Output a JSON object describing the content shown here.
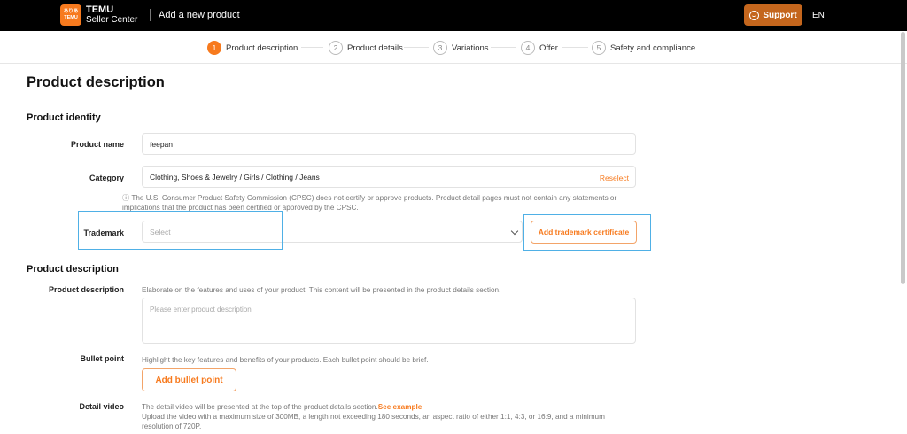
{
  "header": {
    "logo_line1": "ありあ",
    "logo_line2": "TEMU",
    "brand_name": "TEMU",
    "brand_sub": "Seller Center",
    "page_title": "Add a new product",
    "support_label": "Support",
    "language": "EN"
  },
  "steps": [
    {
      "num": "1",
      "label": "Product description"
    },
    {
      "num": "2",
      "label": "Product details"
    },
    {
      "num": "3",
      "label": "Variations"
    },
    {
      "num": "4",
      "label": "Offer"
    },
    {
      "num": "5",
      "label": "Safety and compliance"
    }
  ],
  "main": {
    "title": "Product description",
    "identity": {
      "section_title": "Product identity",
      "product_name_label": "Product name",
      "product_name_value": "feepan",
      "category_label": "Category",
      "category_value": "Clothing, Shoes & Jewelry / Girls / Clothing / Jeans",
      "reselect_label": "Reselect",
      "cpsc_note_line1": "ⓘ The U.S. Consumer Product Safety Commission (CPSC) does not certify or approve products. Product detail pages must not contain any statements or",
      "cpsc_note_line2": "implications that the product has been certified or approved by the CPSC.",
      "trademark_label": "Trademark",
      "trademark_placeholder": "Select",
      "add_certificate_label": "Add trademark certificate"
    },
    "description": {
      "section_title": "Product description",
      "desc_label": "Product description",
      "desc_hint": "Elaborate on the features and uses of your product. This content will be presented in the product details section.",
      "desc_placeholder": "Please enter product description",
      "bullet_label": "Bullet point",
      "bullet_hint": "Highlight the key features and benefits of your products. Each bullet point should be brief.",
      "add_bullet_label": "Add bullet point",
      "video_label": "Detail video",
      "video_hint": "The detail video will be presented at the top of the product details section.",
      "see_example": "See example",
      "video_req_line1": "Upload the video with a maximum size of 300MB, a length not exceeding 180 seconds, an aspect ratio of either 1:1, 4:3, or 16:9, and a minimum",
      "video_req_line2": "resolution of 720P."
    }
  },
  "colors": {
    "accent": "#f77a1e",
    "highlight": "#4fb0e6",
    "topbar": "#000000"
  }
}
